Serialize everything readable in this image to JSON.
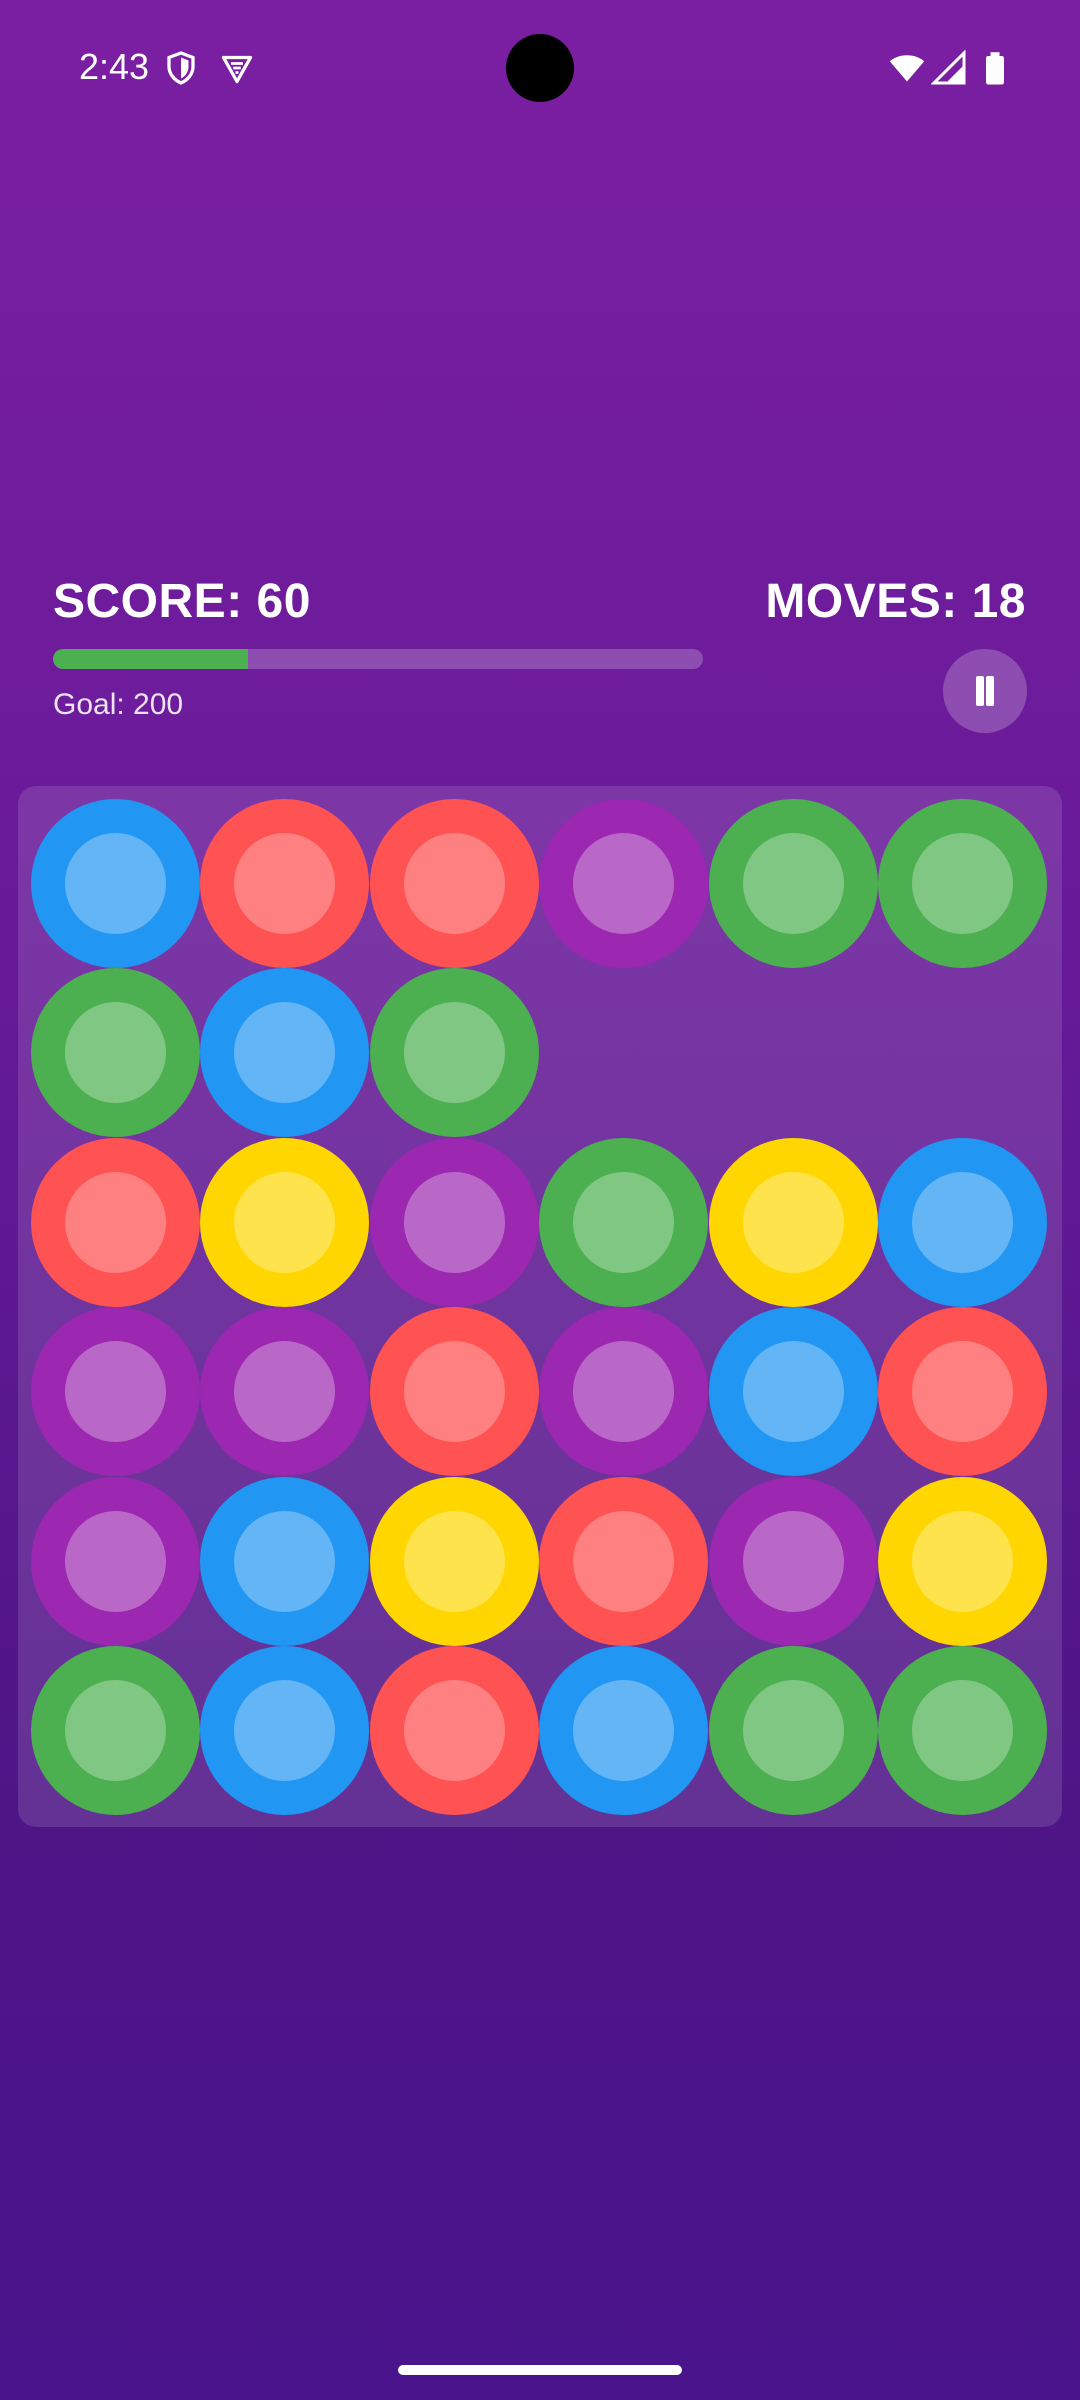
{
  "status_bar": {
    "time": "2:43",
    "left_icons": [
      "shield-icon",
      "vpn-icon"
    ],
    "right_icons": [
      "wifi-icon",
      "cellular-signal-icon",
      "battery-icon"
    ]
  },
  "hud": {
    "score_text": "SCORE: 60",
    "moves_text": "MOVES: 18",
    "goal_text": "Goal: 200",
    "progress_fraction": 0.3,
    "pause_icon": "pause-icon"
  },
  "colors": {
    "blue": {
      "outer": "#2196f3",
      "inner": "#64b5f6"
    },
    "red": {
      "outer": "#ff5252",
      "inner": "#ff8080"
    },
    "purple": {
      "outer": "#9c27b0",
      "inner": "#ba68c8"
    },
    "green": {
      "outer": "#4caf50",
      "inner": "#81c784"
    },
    "yellow": {
      "outer": "#ffd600",
      "inner": "#ffe34d"
    },
    "progress": "#4caf50"
  },
  "board": {
    "columns": 6,
    "rows": 6,
    "cells": [
      [
        "blue",
        "red",
        "red",
        "purple",
        "green",
        "green"
      ],
      [
        "green",
        "blue",
        "green",
        null,
        null,
        null
      ],
      [
        "red",
        "yellow",
        "purple",
        "green",
        "yellow",
        "blue"
      ],
      [
        "purple",
        "purple",
        "red",
        "purple",
        "blue",
        "red"
      ],
      [
        "purple",
        "blue",
        "yellow",
        "red",
        "purple",
        "yellow"
      ],
      [
        "green",
        "blue",
        "red",
        "blue",
        "green",
        "green"
      ]
    ]
  }
}
